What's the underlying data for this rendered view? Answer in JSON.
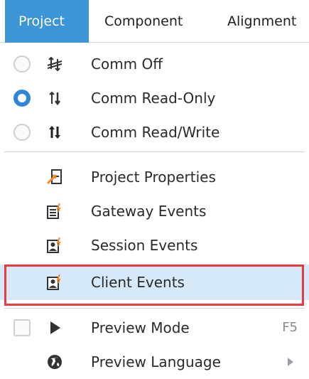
{
  "menubar": {
    "tabs": [
      {
        "label": "Project",
        "active": true
      },
      {
        "label": "Component",
        "active": false
      },
      {
        "label": "Alignment",
        "active": false
      }
    ]
  },
  "menu": {
    "items": [
      {
        "label": "Comm Off",
        "control": "radio",
        "checked": false,
        "icon": "comm-off-icon"
      },
      {
        "label": "Comm Read-Only",
        "control": "radio",
        "checked": true,
        "icon": "comm-read-only-icon"
      },
      {
        "label": "Comm Read/Write",
        "control": "radio",
        "checked": false,
        "icon": "comm-read-write-icon"
      },
      {
        "label": "Project Properties",
        "icon": "project-properties-icon"
      },
      {
        "label": "Gateway Events",
        "icon": "gateway-events-icon"
      },
      {
        "label": "Session Events",
        "icon": "session-events-icon"
      },
      {
        "label": "Client Events",
        "icon": "client-events-icon",
        "highlighted": true
      },
      {
        "label": "Preview Mode",
        "control": "checkbox",
        "checked": false,
        "icon": "play-icon",
        "shortcut": "F5"
      },
      {
        "label": "Preview Language",
        "icon": "globe-icon",
        "has_submenu": true
      }
    ]
  },
  "colors": {
    "active_tab": "#3b95d7",
    "selected_radio": "#2d86d6",
    "highlight_row": "#d6e9f8",
    "annotation_box": "#e83a3f",
    "icon_accent": "#f58a1f"
  }
}
